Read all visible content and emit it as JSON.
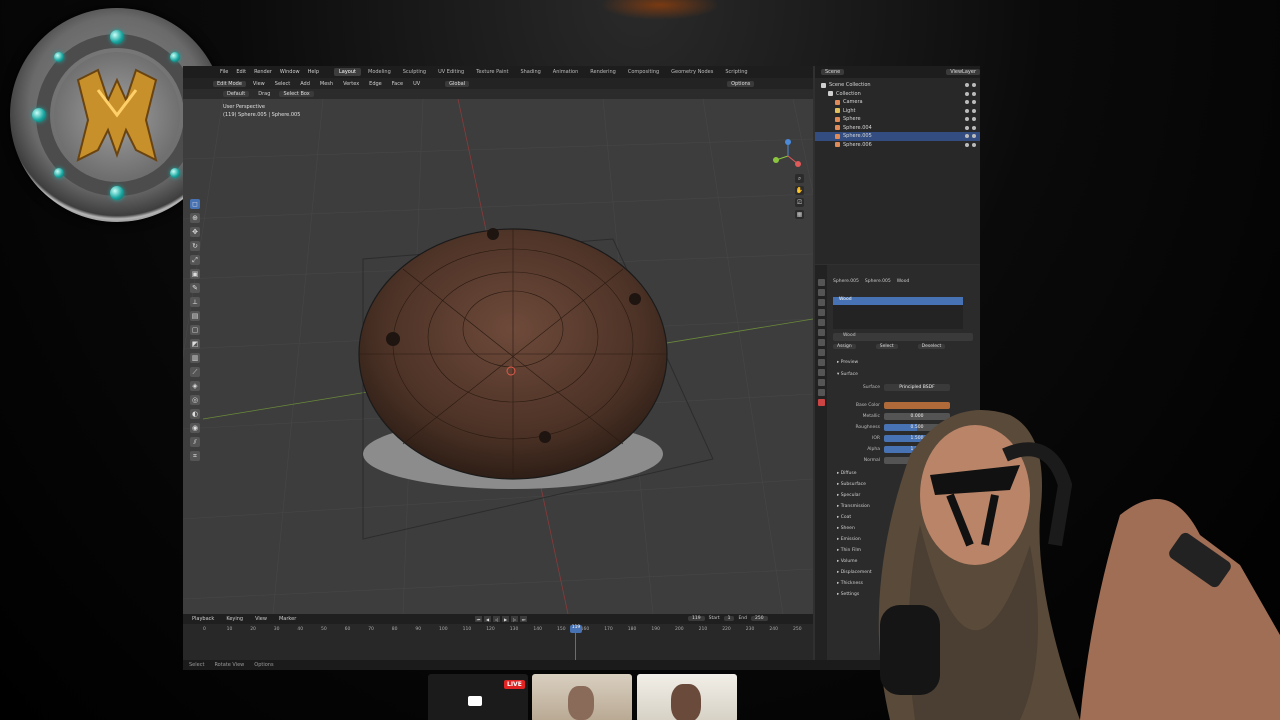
{
  "blender": {
    "menus": [
      "File",
      "Edit",
      "Render",
      "Window",
      "Help"
    ],
    "workspaces": [
      "Layout",
      "Modeling",
      "Sculpting",
      "UV Editing",
      "Texture Paint",
      "Shading",
      "Animation",
      "Rendering",
      "Compositing",
      "Geometry Nodes",
      "Scripting"
    ],
    "active_workspace": "Layout",
    "header": {
      "mode": "Edit Mode",
      "view": "View",
      "select": "Select",
      "add": "Add",
      "mesh": "Mesh",
      "vertex": "Vertex",
      "edge": "Edge",
      "face": "Face",
      "uv": "UV",
      "transform_orientation": "Global",
      "options": "Options"
    },
    "tool_header": {
      "orientation": "Default",
      "drag": "Drag",
      "select_mode": "Select Box"
    },
    "viewport": {
      "projection": "User Perspective",
      "object_info": "(119) Sphere.005 | Sphere.005"
    },
    "timeline": {
      "menus": [
        "Playback",
        "Keying",
        "View",
        "Marker"
      ],
      "current_frame": "119",
      "start_label": "Start",
      "start": "1",
      "end_label": "End",
      "end": "250",
      "ticks": [
        "0",
        "10",
        "20",
        "30",
        "40",
        "50",
        "60",
        "70",
        "80",
        "90",
        "100",
        "110",
        "120",
        "130",
        "140",
        "150",
        "160",
        "170",
        "180",
        "190",
        "200",
        "210",
        "220",
        "230",
        "240",
        "250"
      ],
      "playhead_label": "119"
    },
    "status": [
      "Select",
      "Rotate View",
      "Options"
    ],
    "outliner": {
      "header": "Scene",
      "view_layer": "ViewLayer",
      "rows": [
        {
          "label": "Scene Collection",
          "indent": 0,
          "color": "#d0d0d0"
        },
        {
          "label": "Collection",
          "indent": 1,
          "color": "#d0d0d0"
        },
        {
          "label": "Camera",
          "indent": 2,
          "color": "#e08a5a"
        },
        {
          "label": "Light",
          "indent": 2,
          "color": "#e0c05a"
        },
        {
          "label": "Sphere",
          "indent": 2,
          "color": "#e08a5a"
        },
        {
          "label": "Sphere.004",
          "indent": 2,
          "color": "#e08a5a"
        },
        {
          "label": "Sphere.005",
          "indent": 2,
          "color": "#e08a5a",
          "selected": true
        },
        {
          "label": "Sphere.006",
          "indent": 2,
          "color": "#e08a5a"
        }
      ]
    },
    "properties": {
      "breadcrumb": [
        "Sphere.005",
        "Sphere.005",
        "Wood"
      ],
      "slot": "Wood",
      "material": "Wood",
      "assign": "Assign",
      "select": "Select",
      "deselect": "Deselect",
      "preview": "Preview",
      "surface_section": "Surface",
      "surface_label": "Surface",
      "surface_value": "Principled BSDF",
      "fields": [
        {
          "label": "Base Color",
          "value": "",
          "color": "#b06a3a"
        },
        {
          "label": "Metallic",
          "value": "0.000",
          "fill": 0
        },
        {
          "label": "Roughness",
          "value": "0.500",
          "fill": 0.5
        },
        {
          "label": "IOR",
          "value": "1.500",
          "fill": 1
        },
        {
          "label": "Alpha",
          "value": "1.000",
          "fill": 1
        },
        {
          "label": "Normal",
          "value": "Default",
          "fill": 0
        }
      ],
      "sections": [
        "Diffuse",
        "Subsurface",
        "Specular",
        "Transmission",
        "Coat",
        "Sheen",
        "Emission",
        "Thin Film",
        "Volume",
        "Displacement",
        "Thickness",
        "Settings"
      ]
    }
  },
  "overlay": {
    "live_badge": "LIVE"
  },
  "colors": {
    "accent": "#4772b3",
    "live": "#e02424",
    "logo_gem": "#1aa6a0",
    "logo_gold": "#c8902a"
  }
}
